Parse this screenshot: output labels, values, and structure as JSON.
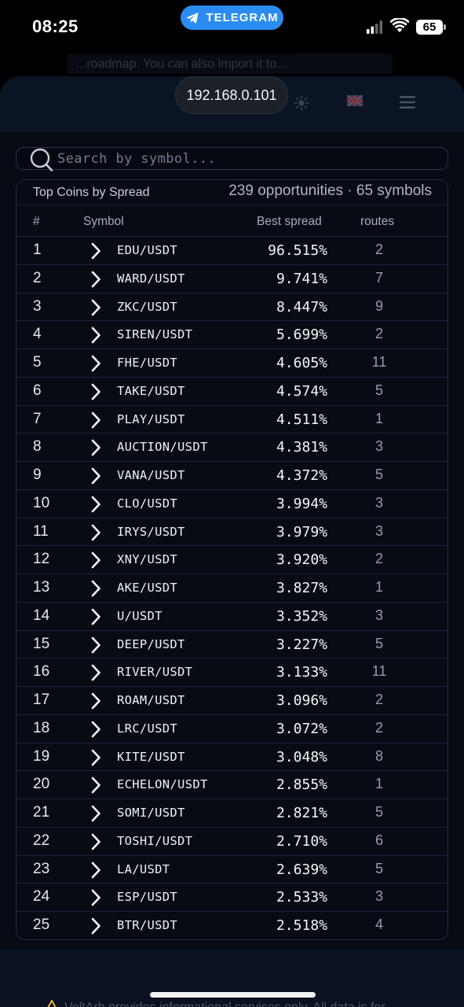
{
  "status_bar": {
    "time": "08:25",
    "app_pill": "TELEGRAM",
    "battery": "65"
  },
  "ghost_banner": "...roadmap. You can also import it to...",
  "header": {
    "host": "192.168.0.101",
    "icons": [
      "sun-icon",
      "uk-flag-icon",
      "hamburger-menu-icon"
    ]
  },
  "search": {
    "placeholder": "Search by symbol..."
  },
  "table": {
    "title": "Top Coins by Spread",
    "summary": "239 opportunities · 65 symbols",
    "columns": {
      "rank": "#",
      "symbol": "Symbol",
      "spread": "Best spread",
      "routes": "routes"
    },
    "rows": [
      {
        "rank": "1",
        "symbol": "EDU/USDT",
        "spread": "96.515%",
        "routes": "2"
      },
      {
        "rank": "2",
        "symbol": "WARD/USDT",
        "spread": "9.741%",
        "routes": "7"
      },
      {
        "rank": "3",
        "symbol": "ZKC/USDT",
        "spread": "8.447%",
        "routes": "9"
      },
      {
        "rank": "4",
        "symbol": "SIREN/USDT",
        "spread": "5.699%",
        "routes": "2"
      },
      {
        "rank": "5",
        "symbol": "FHE/USDT",
        "spread": "4.605%",
        "routes": "11"
      },
      {
        "rank": "6",
        "symbol": "TAKE/USDT",
        "spread": "4.574%",
        "routes": "5"
      },
      {
        "rank": "7",
        "symbol": "PLAY/USDT",
        "spread": "4.511%",
        "routes": "1"
      },
      {
        "rank": "8",
        "symbol": "AUCTION/USDT",
        "spread": "4.381%",
        "routes": "3"
      },
      {
        "rank": "9",
        "symbol": "VANA/USDT",
        "spread": "4.372%",
        "routes": "5"
      },
      {
        "rank": "10",
        "symbol": "CLO/USDT",
        "spread": "3.994%",
        "routes": "3"
      },
      {
        "rank": "11",
        "symbol": "IRYS/USDT",
        "spread": "3.979%",
        "routes": "3"
      },
      {
        "rank": "12",
        "symbol": "XNY/USDT",
        "spread": "3.920%",
        "routes": "2"
      },
      {
        "rank": "13",
        "symbol": "AKE/USDT",
        "spread": "3.827%",
        "routes": "1"
      },
      {
        "rank": "14",
        "symbol": "U/USDT",
        "spread": "3.352%",
        "routes": "3"
      },
      {
        "rank": "15",
        "symbol": "DEEP/USDT",
        "spread": "3.227%",
        "routes": "5"
      },
      {
        "rank": "16",
        "symbol": "RIVER/USDT",
        "spread": "3.133%",
        "routes": "11"
      },
      {
        "rank": "17",
        "symbol": "ROAM/USDT",
        "spread": "3.096%",
        "routes": "2"
      },
      {
        "rank": "18",
        "symbol": "LRC/USDT",
        "spread": "3.072%",
        "routes": "2"
      },
      {
        "rank": "19",
        "symbol": "KITE/USDT",
        "spread": "3.048%",
        "routes": "8"
      },
      {
        "rank": "20",
        "symbol": "ECHELON/USDT",
        "spread": "2.855%",
        "routes": "1"
      },
      {
        "rank": "21",
        "symbol": "SOMI/USDT",
        "spread": "2.821%",
        "routes": "5"
      },
      {
        "rank": "22",
        "symbol": "TOSHI/USDT",
        "spread": "2.710%",
        "routes": "6"
      },
      {
        "rank": "23",
        "symbol": "LA/USDT",
        "spread": "2.639%",
        "routes": "5"
      },
      {
        "rank": "24",
        "symbol": "ESP/USDT",
        "spread": "2.533%",
        "routes": "3"
      },
      {
        "rank": "25",
        "symbol": "BTR/USDT",
        "spread": "2.518%",
        "routes": "4"
      }
    ]
  },
  "footer": {
    "disclaimer": "VoltArb provides informational services only. All data is for..."
  },
  "colors": {
    "telegram": "#2a8cf0",
    "background": "#070b14",
    "header": "#0a1424",
    "warning": "#e8b04a"
  }
}
